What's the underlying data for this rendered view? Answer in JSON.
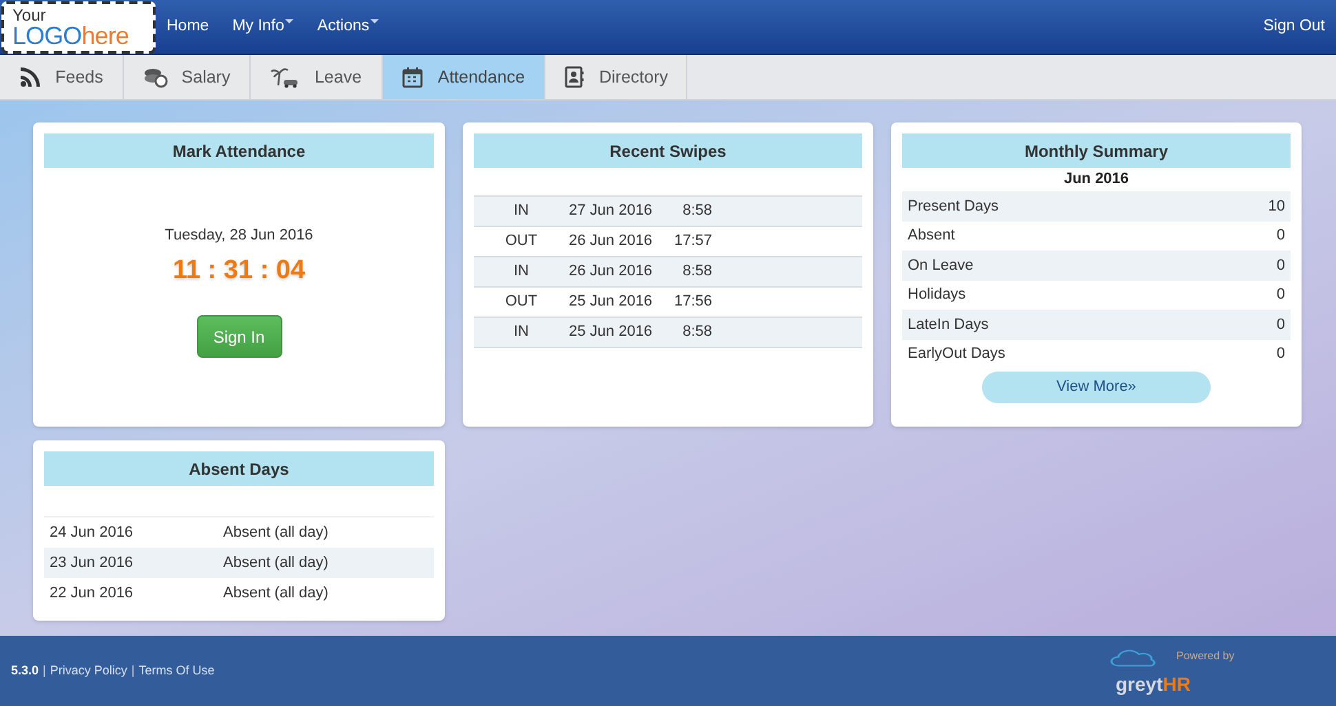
{
  "logo": {
    "line1": "Your",
    "part1": "LOGO",
    "part2": "here"
  },
  "nav": [
    {
      "label": "Home",
      "dropdown": false
    },
    {
      "label": "My Info",
      "dropdown": true
    },
    {
      "label": "Actions",
      "dropdown": true
    }
  ],
  "sign_out": "Sign Out",
  "tabs": [
    {
      "label": "Feeds",
      "selected": false
    },
    {
      "label": "Salary",
      "selected": false
    },
    {
      "label": "Leave",
      "selected": false
    },
    {
      "label": "Attendance",
      "selected": true
    },
    {
      "label": "Directory",
      "selected": false
    }
  ],
  "mark_attendance": {
    "title": "Mark Attendance",
    "date": "Tuesday, 28 Jun 2016",
    "time": "11 : 31 : 04",
    "button": "Sign In"
  },
  "recent_swipes": {
    "title": "Recent Swipes",
    "rows": [
      {
        "direction": "IN",
        "date": "27 Jun 2016",
        "time": "8:58"
      },
      {
        "direction": "OUT",
        "date": "26 Jun 2016",
        "time": "17:57"
      },
      {
        "direction": "IN",
        "date": "26 Jun 2016",
        "time": "8:58"
      },
      {
        "direction": "OUT",
        "date": "25 Jun 2016",
        "time": "17:56"
      },
      {
        "direction": "IN",
        "date": "25 Jun 2016",
        "time": "8:58"
      }
    ]
  },
  "monthly_summary": {
    "title": "Monthly Summary",
    "month": "Jun 2016",
    "rows": [
      {
        "label": "Present Days",
        "value": "10"
      },
      {
        "label": "Absent",
        "value": "0"
      },
      {
        "label": "On Leave",
        "value": "0"
      },
      {
        "label": "Holidays",
        "value": "0"
      },
      {
        "label": "LateIn Days",
        "value": "0"
      },
      {
        "label": "EarlyOut Days",
        "value": "0"
      }
    ],
    "button": "View More»"
  },
  "absent_days": {
    "title": "Absent Days",
    "rows": [
      {
        "date": "24 Jun 2016",
        "status": "Absent (all day)"
      },
      {
        "date": "23 Jun 2016",
        "status": "Absent (all day)"
      },
      {
        "date": "22 Jun 2016",
        "status": "Absent (all day)"
      }
    ]
  },
  "footer": {
    "version": "5.3.0",
    "links": [
      "Privacy Policy",
      "Terms Of Use"
    ],
    "separators": [
      "|",
      "|"
    ],
    "powered_by": "Powered by",
    "brand1": "greyt",
    "brand2": "HR"
  }
}
